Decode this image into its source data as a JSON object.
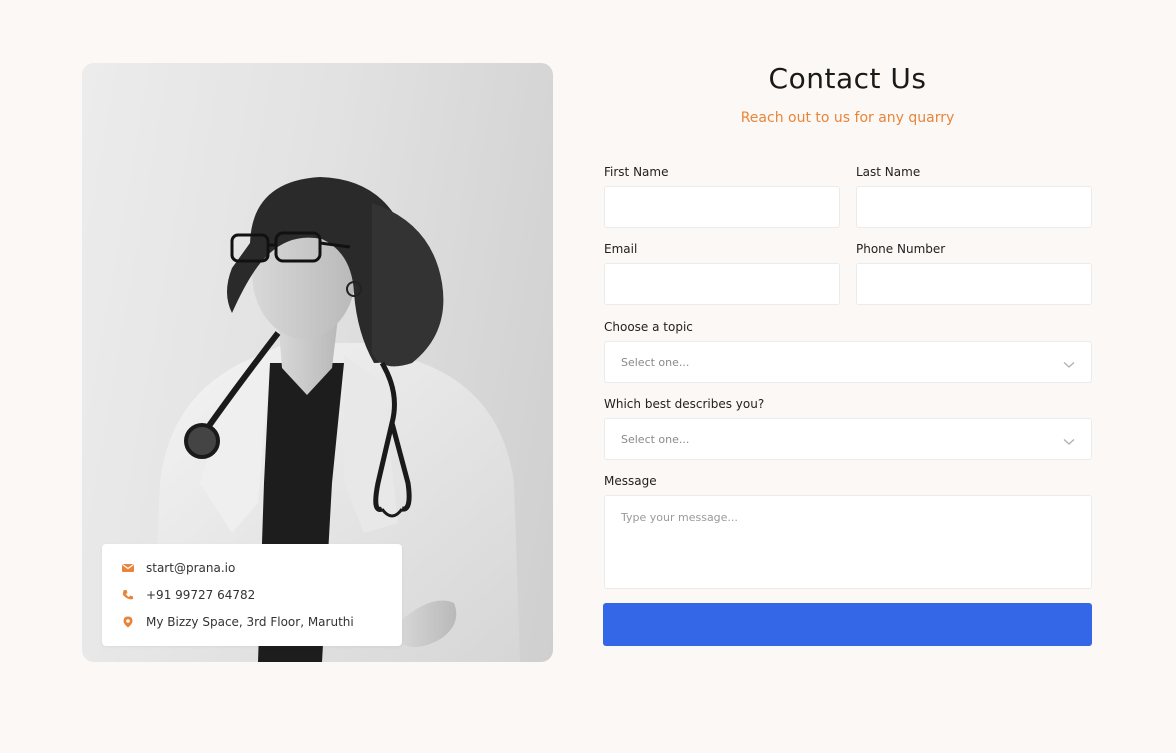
{
  "header": {
    "title": "Contact Us",
    "subtitle": "Reach out to us for any quarry"
  },
  "contact_info": {
    "email": "start@prana.io",
    "phone": "+91 99727 64782",
    "address": "My Bizzy Space, 3rd Floor, Maruthi",
    "accent_color": "#e8853a"
  },
  "form": {
    "first_name": {
      "label": "First Name",
      "value": "",
      "placeholder": ""
    },
    "last_name": {
      "label": "Last Name",
      "value": "",
      "placeholder": ""
    },
    "email": {
      "label": "Email",
      "value": "",
      "placeholder": ""
    },
    "phone": {
      "label": "Phone Number",
      "value": "",
      "placeholder": ""
    },
    "topic": {
      "label": "Choose a topic",
      "selected": "Select one..."
    },
    "describes": {
      "label": "Which best describes you?",
      "selected": "Select one..."
    },
    "message": {
      "label": "Message",
      "value": "",
      "placeholder": "Type your message..."
    },
    "submit": {
      "label": "",
      "color": "#3367e8"
    }
  },
  "icons": {
    "email": "envelope-icon",
    "phone": "phone-icon",
    "address": "location-pin-icon",
    "select": "chevron-down-icon"
  }
}
